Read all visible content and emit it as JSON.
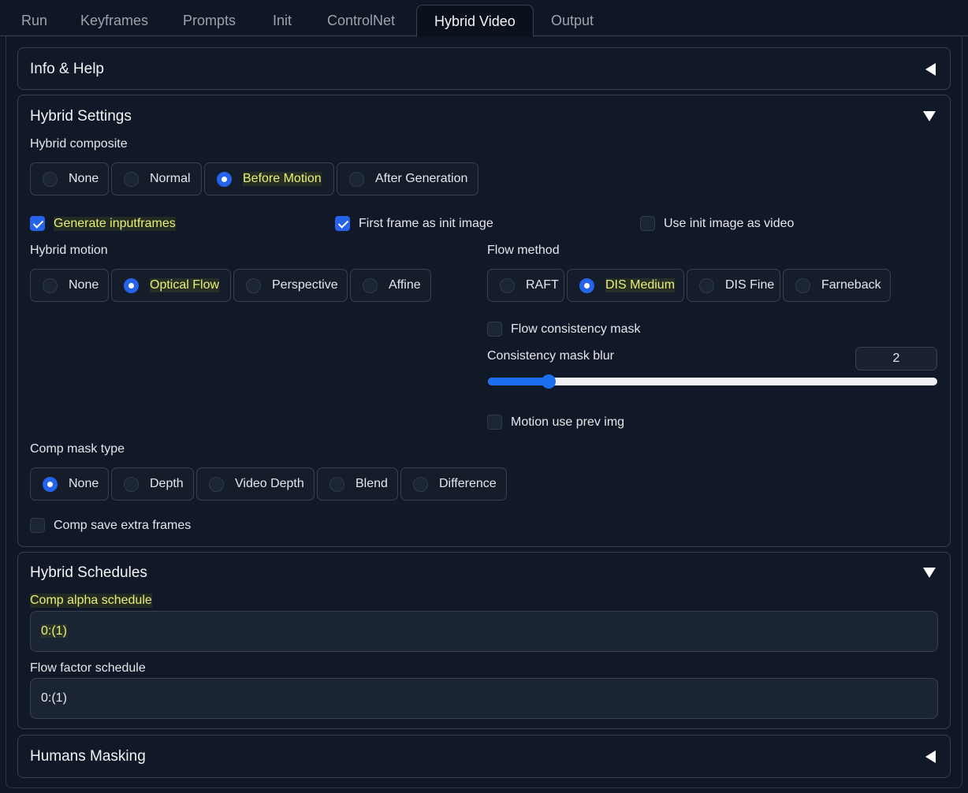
{
  "tabs": [
    {
      "label": "Run",
      "active": false
    },
    {
      "label": "Keyframes",
      "active": false
    },
    {
      "label": "Prompts",
      "active": false
    },
    {
      "label": "Init",
      "active": false
    },
    {
      "label": "ControlNet",
      "active": false
    },
    {
      "label": "Hybrid Video",
      "active": true
    },
    {
      "label": "Output",
      "active": false
    }
  ],
  "info_help": {
    "title": "Info & Help",
    "state": "collapsed",
    "icon": "caret-left-icon"
  },
  "hybrid_settings": {
    "title": "Hybrid Settings",
    "state": "expanded",
    "icon": "caret-down-icon",
    "hybrid_composite": {
      "label": "Hybrid composite",
      "options": [
        "None",
        "Normal",
        "Before Motion",
        "After Generation"
      ],
      "selected": "Before Motion"
    },
    "generate_inputframes": {
      "label": "Generate inputframes",
      "checked": true
    },
    "first_frame_as_init": {
      "label": "First frame as init image",
      "checked": true
    },
    "use_init_as_video": {
      "label": "Use init image as video",
      "checked": false
    },
    "hybrid_motion": {
      "label": "Hybrid motion",
      "options": [
        "None",
        "Optical Flow",
        "Perspective",
        "Affine"
      ],
      "selected": "Optical Flow"
    },
    "flow_method": {
      "label": "Flow method",
      "options": [
        "RAFT",
        "DIS Medium",
        "DIS Fine",
        "Farneback"
      ],
      "selected": "DIS Medium"
    },
    "flow_consistency_mask": {
      "label": "Flow consistency mask",
      "checked": false
    },
    "consistency_mask_blur": {
      "label": "Consistency mask blur",
      "value": "2",
      "fraction": 0.135
    },
    "motion_use_prev_img": {
      "label": "Motion use prev img",
      "checked": false
    },
    "comp_mask_type": {
      "label": "Comp mask type",
      "options": [
        "None",
        "Depth",
        "Video Depth",
        "Blend",
        "Difference"
      ],
      "selected": "None"
    },
    "comp_save_extra_frames": {
      "label": "Comp save extra frames",
      "checked": false
    }
  },
  "hybrid_schedules": {
    "title": "Hybrid Schedules",
    "state": "expanded",
    "icon": "caret-down-icon",
    "comp_alpha_schedule": {
      "label": "Comp alpha schedule",
      "value": "0:(1)"
    },
    "flow_factor_schedule": {
      "label": "Flow factor schedule",
      "value": "0:(1)"
    }
  },
  "humans_masking": {
    "title": "Humans Masking",
    "state": "collapsed",
    "icon": "caret-left-icon"
  },
  "colors": {
    "accent": "#2563eb",
    "slider": "#1d6ff2",
    "highlight_text": "#e8f075",
    "background": "#0f1624"
  }
}
